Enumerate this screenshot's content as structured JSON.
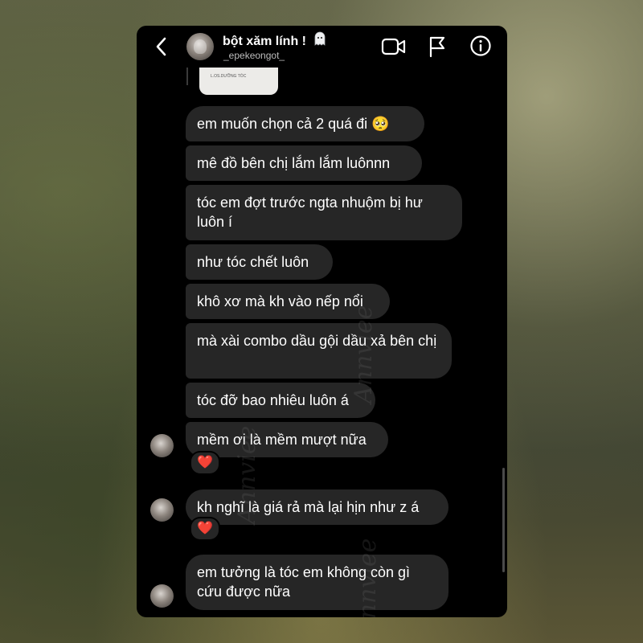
{
  "header": {
    "contact_name": "bột xăm lính !",
    "username": "_epekeongot_",
    "icons": [
      "back-arrow-icon",
      "video-call-icon",
      "flag-icon",
      "info-icon",
      "ghost-emoji-icon"
    ]
  },
  "shared_image": {
    "caption": "L.OS.DƯỠNG TÓC"
  },
  "messages": [
    {
      "text": "em muốn chọn cả 2 quá đi 🥺"
    },
    {
      "text": "mê đồ bên chị lắm lắm luônnn"
    },
    {
      "text": "tóc em đợt trước ngta nhuộm bị hư luôn í"
    },
    {
      "text": "như tóc chết luôn"
    },
    {
      "text": "khô xơ mà kh vào nếp nổi"
    },
    {
      "text": "mà xài combo dầu gội dầu xả bên chị"
    },
    {
      "text": "tóc đỡ bao nhiêu luôn á"
    },
    {
      "text": "mềm ơi là mềm mượt nữa",
      "reaction": "❤️"
    },
    {
      "text": "kh nghĩ là giá rả mà lại hịn như z á",
      "reaction": "❤️"
    },
    {
      "text": "em tưởng là tóc em không còn gì cứu được nữa"
    }
  ],
  "watermark": "Annviee",
  "colors": {
    "bubble": "#262626",
    "background": "#000000",
    "text": "#ffffff"
  }
}
